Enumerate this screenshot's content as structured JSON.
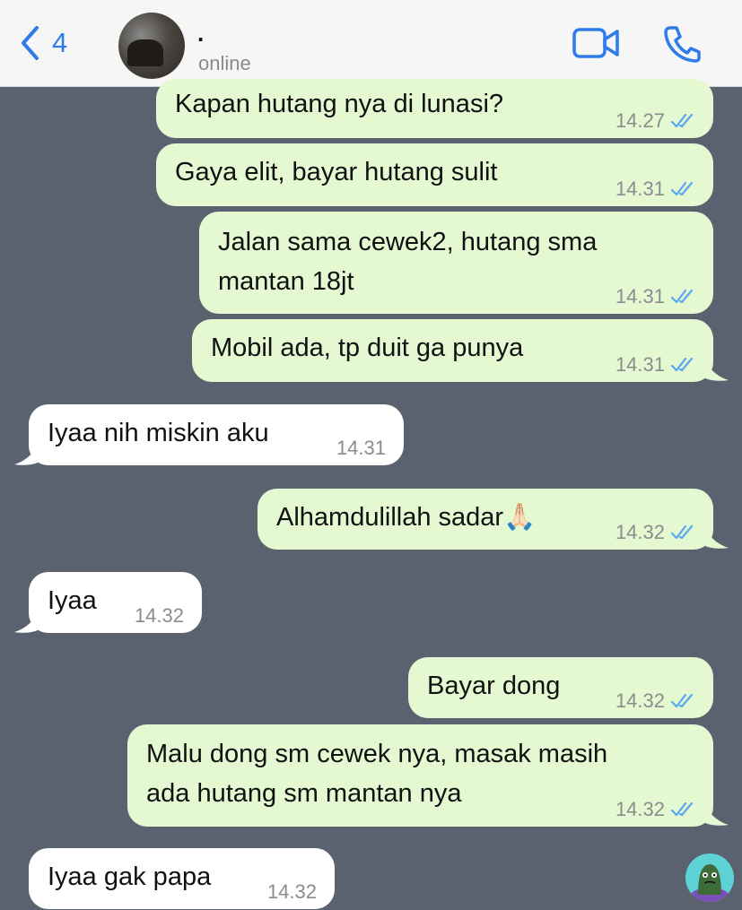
{
  "header": {
    "back_count": "4",
    "contact_name": ".",
    "status": "online"
  },
  "messages": [
    {
      "dir": "out",
      "text": "Kapan hutang nya di lunasi?",
      "time": "14.27",
      "read": true
    },
    {
      "dir": "out",
      "text": "Gaya elit, bayar hutang sulit",
      "time": "14.31",
      "read": true
    },
    {
      "dir": "out",
      "text_line1": "Jalan sama cewek2, hutang sma",
      "text_line2": "mantan 18jt",
      "time": "14.31",
      "read": true
    },
    {
      "dir": "out",
      "text": "Mobil ada, tp duit ga punya",
      "time": "14.31",
      "read": true
    },
    {
      "dir": "in",
      "text": "Iyaa nih miskin aku",
      "time": "14.31"
    },
    {
      "dir": "out",
      "text": "Alhamdulillah sadar🙏🏻",
      "time": "14.32",
      "read": true
    },
    {
      "dir": "in",
      "text": "Iyaa",
      "time": "14.32"
    },
    {
      "dir": "out",
      "text": "Bayar dong",
      "time": "14.32",
      "read": true
    },
    {
      "dir": "out",
      "text_line1": "Malu dong sm cewek nya, masak masih",
      "text_line2": "ada hutang sm mantan nya",
      "time": "14.32",
      "read": true
    },
    {
      "dir": "in",
      "text": "Iyaa gak papa",
      "time": "14.32"
    }
  ],
  "colors": {
    "background": "#5a6270",
    "outgoing_bubble": "#e4f9d2",
    "incoming_bubble": "#ffffff",
    "accent": "#2f7bea",
    "read_ticks": "#5aa8f0"
  },
  "icons": [
    "back-chevron-icon",
    "video-call-icon",
    "phone-call-icon",
    "double-check-icon",
    "sticker-icon"
  ]
}
